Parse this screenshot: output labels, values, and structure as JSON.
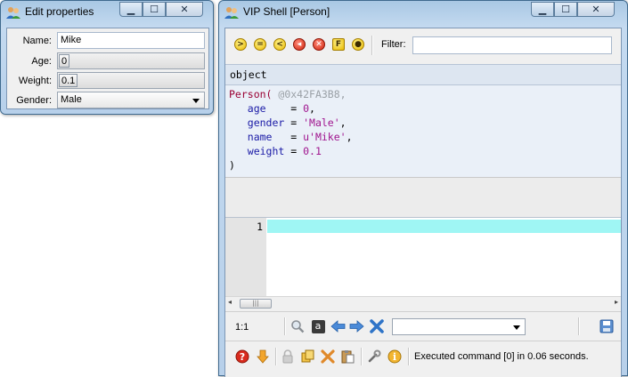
{
  "edit_window": {
    "title": "Edit properties",
    "fields": {
      "name_label": "Name:",
      "name_value": "Mike",
      "age_label": "Age:",
      "age_value": "0",
      "weight_label": "Weight:",
      "weight_value": "0.1",
      "gender_label": "Gender:",
      "gender_value": "Male"
    }
  },
  "shell_window": {
    "title": "VIP Shell [Person]",
    "filter_label": "Filter:",
    "filter_value": "",
    "toolbar_icons": [
      "forward-icon",
      "equals-icon",
      "back-icon",
      "stop-icon",
      "close-icon",
      "function-icon",
      "eye-icon"
    ],
    "toolbar_glyphs": [
      ">",
      "=",
      "<",
      "◀",
      "✕",
      "F",
      "◉"
    ],
    "object_header": "object",
    "object_repr": {
      "open": "Person(",
      "address": "@0x42FA3B8,",
      "attrs": [
        {
          "name": "age",
          "eq": "    = ",
          "value": "0",
          "trail": ","
        },
        {
          "name": "gender",
          "eq": " = ",
          "value": "'Male'",
          "trail": ","
        },
        {
          "name": "name",
          "eq": "   = ",
          "value": "u'Mike'",
          "trail": ","
        },
        {
          "name": "weight",
          "eq": " = ",
          "value": "0.1",
          "trail": ""
        }
      ],
      "close": ")"
    },
    "editor_line_number": "1",
    "cursor_position": "1:1",
    "status_text": "Executed command [0] in 0.06 seconds.",
    "nav_search_icon": "magnifier-icon",
    "colors": {
      "highlight_line": "#9ff6f4",
      "object_panel": "#eaf0f8",
      "object_header": "#dde6f1"
    }
  }
}
